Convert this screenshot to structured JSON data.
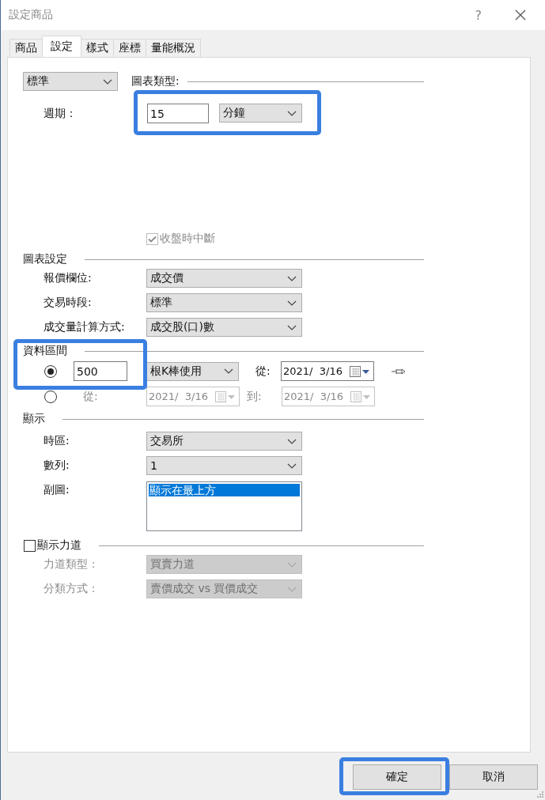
{
  "window": {
    "title": "設定商品",
    "help": "?"
  },
  "tabs": [
    {
      "label": "商品",
      "selected": false
    },
    {
      "label": "設定",
      "selected": true
    },
    {
      "label": "樣式",
      "selected": false
    },
    {
      "label": "座標",
      "selected": false
    },
    {
      "label": "量能概況",
      "selected": false
    }
  ],
  "chart_type": {
    "value": "標準",
    "label": "圖表類型:"
  },
  "period": {
    "label": "週期：",
    "value": "15",
    "unit": "分鐘",
    "highlighted": true
  },
  "break_at_close": {
    "label": "收盤時中斷",
    "checked": true,
    "disabled": true
  },
  "chart_settings": {
    "title": "圖表設定",
    "rows": [
      {
        "label": "報價欄位:",
        "value": "成交價"
      },
      {
        "label": "交易時段:",
        "value": "標準"
      },
      {
        "label": "成交量計算方式:",
        "value": "成交股(口)數"
      }
    ]
  },
  "data_range": {
    "title": "資料區間",
    "highlighted": true,
    "options": [
      {
        "kind": "bars",
        "selected": true,
        "value": "500",
        "mode": "根K棒使用",
        "from_label": "從:",
        "from_date": "2021/  3/16"
      },
      {
        "kind": "range",
        "selected": false,
        "from_label": "從:",
        "from_date": "2021/  3/16",
        "to_label": "到:",
        "to_date": "2021/  3/16"
      }
    ]
  },
  "display": {
    "title": "顯示",
    "rows": [
      {
        "kind": "dropdown",
        "label": "時區:",
        "value": "交易所"
      },
      {
        "kind": "dropdown",
        "label": "數列:",
        "value": "1"
      },
      {
        "kind": "listbox",
        "label": "副圖:",
        "items": [
          {
            "label": "顯示在最上方",
            "selected": true
          }
        ]
      }
    ]
  },
  "force": {
    "label": "顯示力道",
    "checked": false,
    "rows": [
      {
        "label": "力道類型：",
        "value": "買賣力道"
      },
      {
        "label": "分類方式：",
        "value": "賣價成交 vs 買價成交"
      }
    ]
  },
  "buttons": [
    {
      "label": "確定",
      "highlighted": true
    },
    {
      "label": "取消",
      "highlighted": false
    }
  ]
}
